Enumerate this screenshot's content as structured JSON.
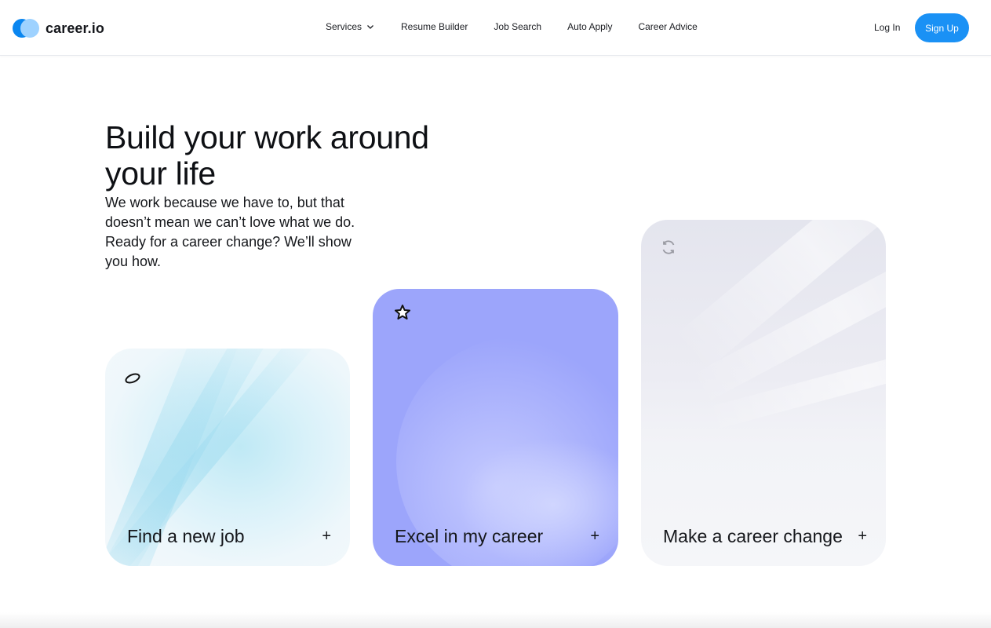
{
  "header": {
    "logo_text": "career.io",
    "nav": [
      {
        "label": "Services"
      },
      {
        "label": "Resume Builder"
      },
      {
        "label": "Job Search"
      },
      {
        "label": "Auto Apply"
      },
      {
        "label": "Career Advice"
      }
    ],
    "login_label": "Log In",
    "signup_label": "Sign Up"
  },
  "hero": {
    "title": "Build your work around your life",
    "subtitle": "We work because we have to, but that doesn’t mean we can’t love what we do. Ready for a career change? We’ll show you how."
  },
  "cards": [
    {
      "label": "Find a new job",
      "icon": "ring-icon",
      "plus": "+"
    },
    {
      "label": "Excel in my career",
      "icon": "star-icon",
      "plus": "+"
    },
    {
      "label": "Make a career change",
      "icon": "refresh-icon",
      "plus": "+"
    }
  ],
  "colors": {
    "brand_blue": "#1a91f5",
    "logo_light": "#9ed2ff",
    "card_excel": "#9ca5fb",
    "card_find": "#d8f1f9",
    "card_change": "#ececf3"
  }
}
